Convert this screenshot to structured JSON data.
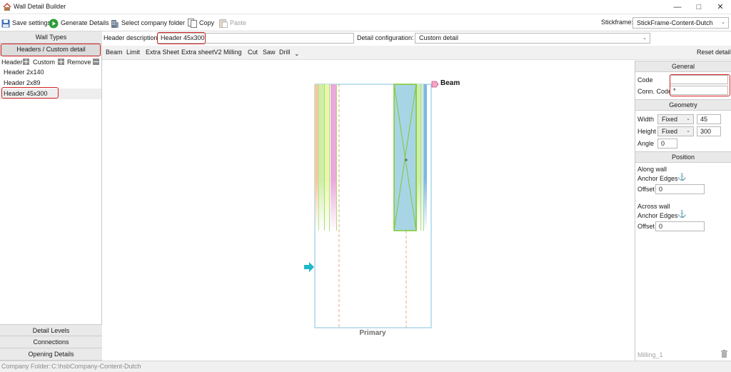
{
  "window": {
    "title": "Wall Detail Builder"
  },
  "toolbar": {
    "save_settings": "Save settings",
    "generate_details": "Generate Details",
    "select_company_folder": "Select company folder",
    "copy": "Copy",
    "paste": "Paste",
    "stickframe_label": "Stickframe:",
    "stickframe_value": "StickFrame-Content-Dutch"
  },
  "left": {
    "wall_types": "Wall Types",
    "headers_custom_detail": "Headers / Custom detail",
    "header_label": "Header",
    "custom_label": "Custom",
    "remove_label": "Remove",
    "items": [
      "Header 2x140",
      "Header 2x89",
      "Header 45x300"
    ],
    "detail_levels": "Detail Levels",
    "connections": "Connections",
    "opening_details": "Opening Details"
  },
  "header": {
    "description_label": "Header description:",
    "description_value": "Header 45x300",
    "config_label": "Detail configuration:",
    "config_value": "Custom detail"
  },
  "tabs": [
    "Beam",
    "Limit",
    "Extra Sheet",
    "Extra sheetV2",
    "Milling",
    "Cut",
    "Saw",
    "Drill"
  ],
  "tabs_overflow": "⌄",
  "reset_detail": "Reset detail",
  "canvas": {
    "beam_label": "Beam",
    "primary_label": "Primary"
  },
  "right": {
    "general": "General",
    "code_label": "Code",
    "code_value": "",
    "conn_code_label": "Conn. Code",
    "conn_code_value": "*",
    "geometry": "Geometry",
    "width_label": "Width",
    "width_mode": "Fixed",
    "width_value": "45",
    "height_label": "Height",
    "height_mode": "Fixed",
    "height_value": "300",
    "angle_label": "Angle",
    "angle_value": "0",
    "position": "Position",
    "along_wall": "Along wall",
    "anchor_edges_1": "Anchor Edges",
    "offset_label_1": "Offset",
    "offset_value_1": "0",
    "across_wall": "Across wall",
    "anchor_edges_2": "Anchor Edges",
    "offset_label_2": "Offset",
    "offset_value_2": "0",
    "milling_item": "Milling_1"
  },
  "status": {
    "company_folder_label": "Company Folder:",
    "company_folder_path": "C:\\hsbCompany-Content-Dutch"
  },
  "colors": {
    "accent_red": "#d42323",
    "beam_fill": "#a9d4e6",
    "beam_outline": "#7acc2f",
    "arrow": "#1fb8c9"
  }
}
